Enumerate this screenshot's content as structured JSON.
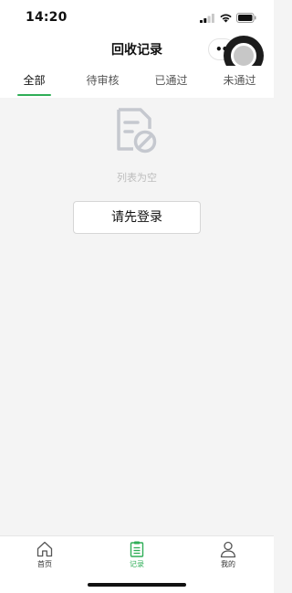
{
  "status_bar": {
    "time": "14:20",
    "icons": [
      "cellular-signal-icon",
      "wifi-icon",
      "battery-icon"
    ]
  },
  "nav": {
    "title": "回收记录",
    "more_icon": "more-dots-icon",
    "close_icon": "close-circle-icon"
  },
  "tabs": [
    {
      "label": "全部",
      "active": true
    },
    {
      "label": "待审核",
      "active": false
    },
    {
      "label": "已通过",
      "active": false
    },
    {
      "label": "未通过",
      "active": false
    }
  ],
  "empty": {
    "icon": "empty-list-icon",
    "text": "列表为空"
  },
  "login_button": {
    "label": "请先登录"
  },
  "tabbar": {
    "items": [
      {
        "label": "首页",
        "icon": "home-icon",
        "active": false
      },
      {
        "label": "记录",
        "icon": "clipboard-icon",
        "active": true
      },
      {
        "label": "我的",
        "icon": "user-icon",
        "active": false
      }
    ]
  },
  "colors": {
    "accent": "#2fae57",
    "background": "#f4f4f4",
    "empty_text": "#bdbdbd"
  }
}
